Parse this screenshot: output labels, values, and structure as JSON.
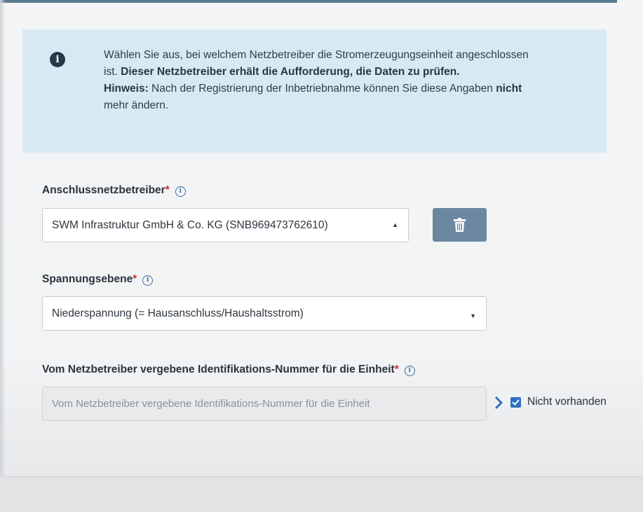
{
  "info": {
    "line1": "Wählen Sie aus, bei welchem Netzbetreiber die Stromerzeugungseinheit angeschlossen",
    "line2_prefix": "ist. ",
    "line2_bold": "Dieser Netzbetreiber erhält die Aufforderung, die Daten zu prüfen.",
    "hint_label": "Hinweis:",
    "hint_text": " Nach der Registrierung der Inbetriebnahme können Sie diese Angaben ",
    "hint_bold": "nicht",
    "hint_end": "mehr ändern.",
    "icon": "info-icon"
  },
  "operator": {
    "label": "Anschlussnetzbetreiber",
    "required": "*",
    "value": "SWM Infrastruktur GmbH & Co. KG (SNB969473762610)",
    "delete_icon": "trash-icon"
  },
  "voltage": {
    "label": "Spannungsebene",
    "required": "*",
    "value": "Niederspannung (= Hausanschluss/Haushaltsstrom)"
  },
  "unit_id": {
    "label": "Vom Netzbetreiber vergebene Identifikations-Nummer für die Einheit",
    "required": "*",
    "placeholder": "Vom Netzbetreiber vergebene Identifikations-Nummer für die Einheit",
    "not_available_label": "Nicht vorhanden",
    "not_available_checked": true
  },
  "colors": {
    "info_background": "#d7eaf4",
    "button": "#6b88a0",
    "required": "#c8323a",
    "checkbox": "#2f6fc2"
  }
}
